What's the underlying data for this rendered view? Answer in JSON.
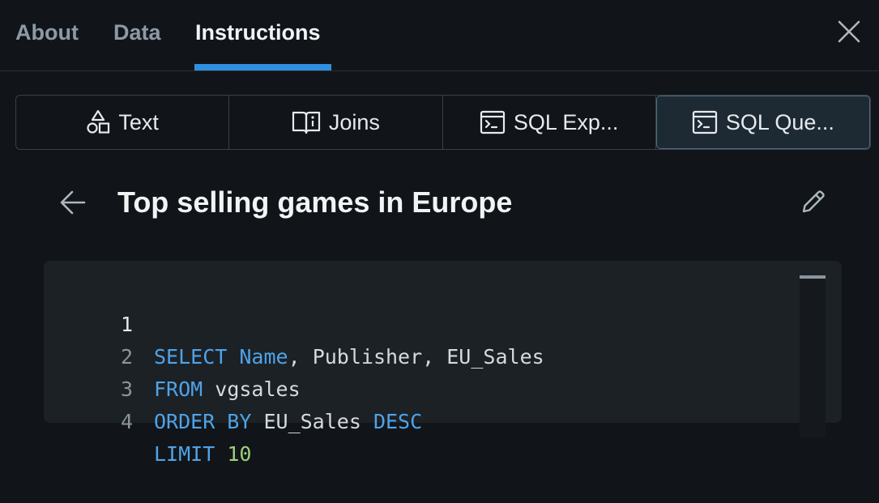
{
  "tabs": [
    {
      "label": "About"
    },
    {
      "label": "Data"
    },
    {
      "label": "Instructions"
    }
  ],
  "segments": [
    {
      "label": "Text",
      "icon": "shapes-icon"
    },
    {
      "label": "Joins",
      "icon": "book-info-icon"
    },
    {
      "label": "SQL Exp...",
      "icon": "terminal-icon"
    },
    {
      "label": "SQL Que...",
      "icon": "terminal-icon"
    }
  ],
  "query": {
    "title": "Top selling games in Europe"
  },
  "code": {
    "lines": [
      {
        "num": "1",
        "tokens": [
          [
            "kw",
            "SELECT"
          ],
          [
            "p",
            " "
          ],
          [
            "kw",
            "Name"
          ],
          [
            "p",
            ", Publisher, EU_Sales"
          ]
        ]
      },
      {
        "num": "2",
        "tokens": [
          [
            "kw",
            "FROM"
          ],
          [
            "p",
            " vgsales"
          ]
        ]
      },
      {
        "num": "3",
        "tokens": [
          [
            "kw",
            "ORDER BY"
          ],
          [
            "p",
            " EU_Sales "
          ],
          [
            "kw",
            "DESC"
          ]
        ]
      },
      {
        "num": "4",
        "tokens": [
          [
            "kw",
            "LIMIT"
          ],
          [
            "p",
            " "
          ],
          [
            "num",
            "10"
          ]
        ]
      }
    ]
  },
  "colors": {
    "accent": "#2f8fe0",
    "keyword": "#4fa3e8",
    "number": "#9fcf7a",
    "background": "#111519"
  }
}
